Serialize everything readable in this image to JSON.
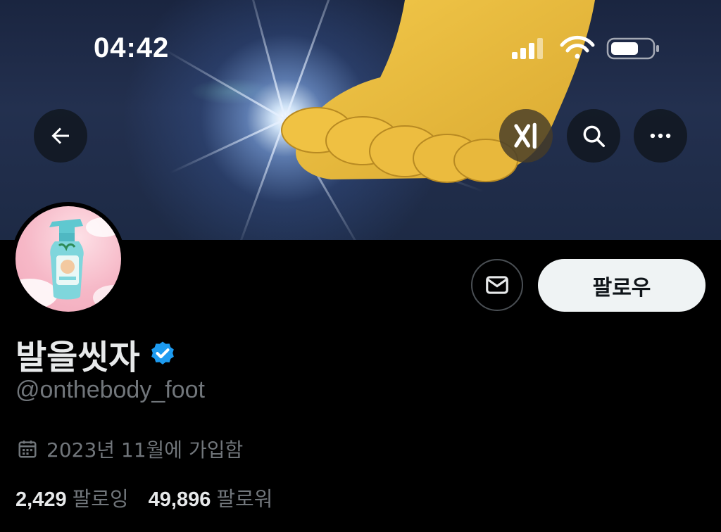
{
  "status_bar": {
    "time": "04:42"
  },
  "colors": {
    "background": "#000000",
    "verified_badge": "#1d9bf0",
    "follow_button_bg": "#eff3f4",
    "secondary_text": "#71767b"
  },
  "header": {
    "back_icon": "arrow-left-icon",
    "grok_icon": "grok-icon",
    "search_icon": "search-icon",
    "more_icon": "more-horizontal-icon"
  },
  "profile": {
    "display_name": "발을씻자",
    "verified": true,
    "handle": "@onthebody_foot",
    "joined": "2023년 11월에 가입함",
    "following_count": "2,429",
    "following_label": "팔로잉",
    "followers_count": "49,896",
    "followers_label": "팔로워"
  },
  "actions": {
    "message_icon": "envelope-icon",
    "follow_label": "팔로우"
  }
}
